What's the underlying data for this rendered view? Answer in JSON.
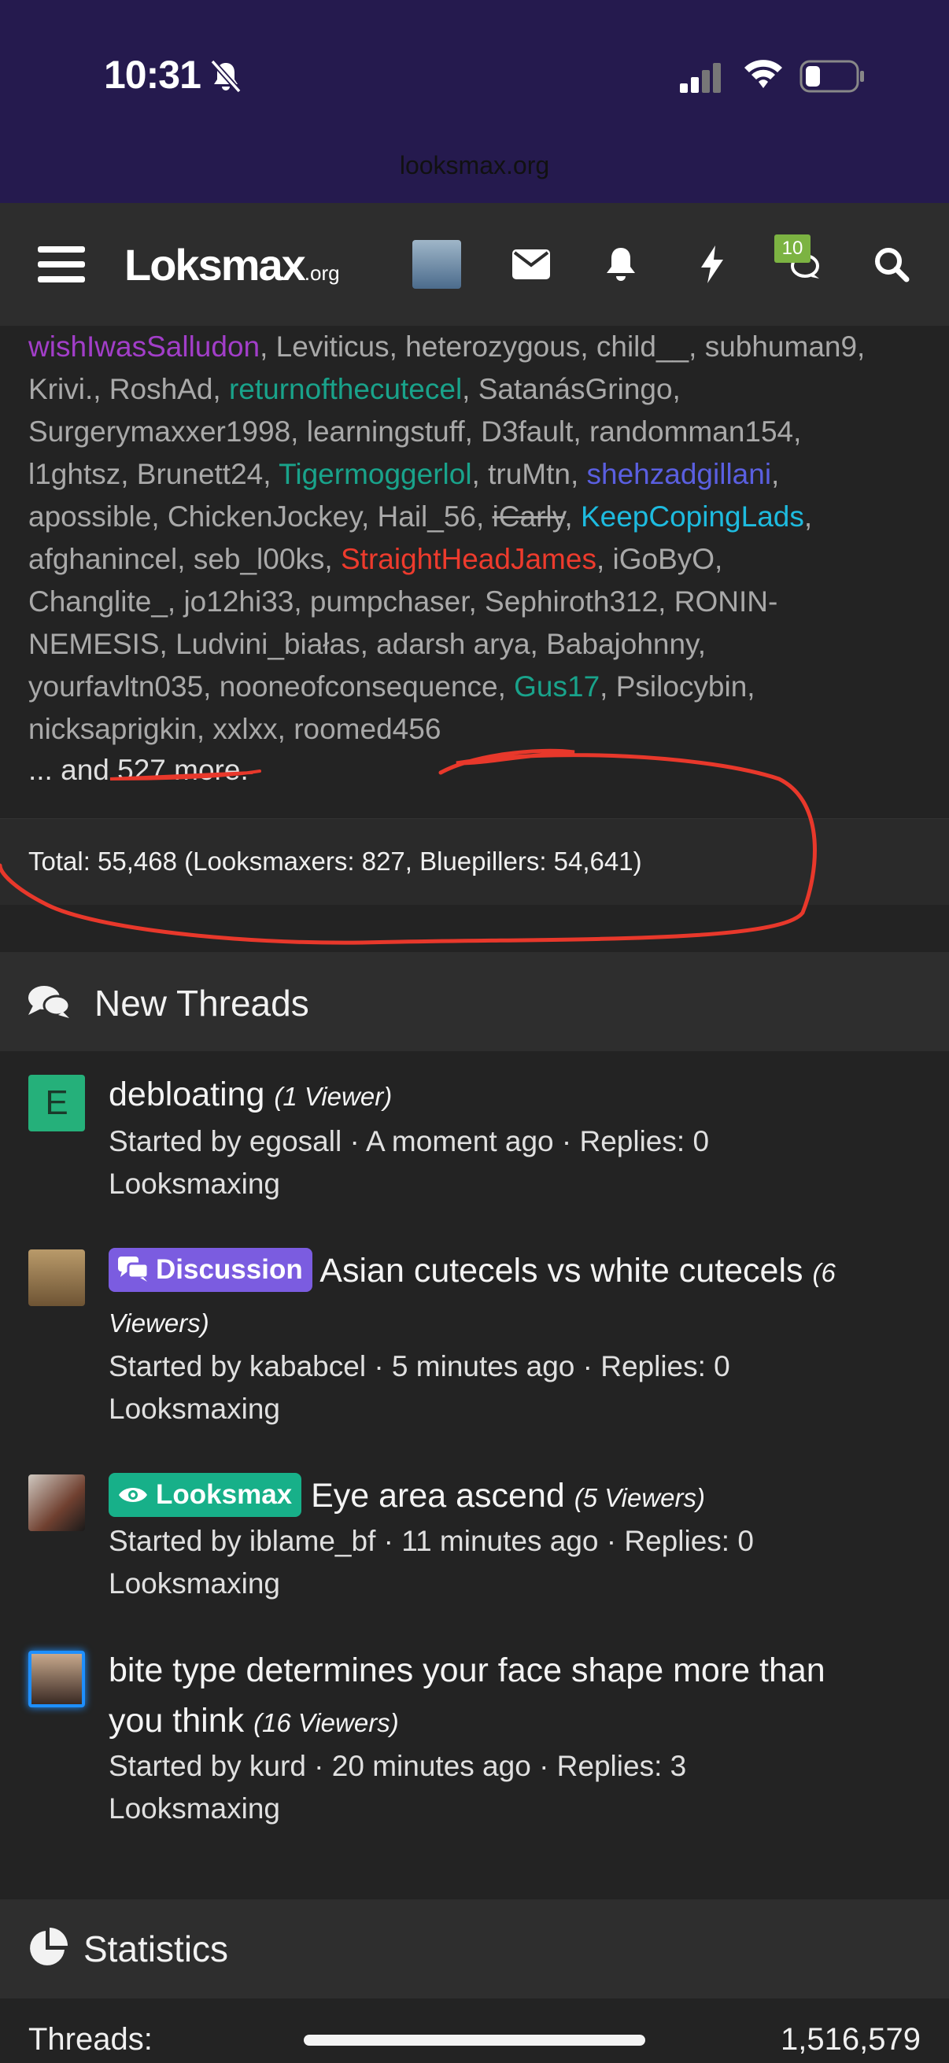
{
  "status": {
    "time": "10:31",
    "url": "looksmax.org"
  },
  "nav": {
    "logo_main": "Lo",
    "logo_rest": "ksmax",
    "logo_suffix": ".org",
    "notification_count": "10",
    "icons": [
      "menu-icon",
      "avatar",
      "mail-icon",
      "bell-icon",
      "lightning-icon",
      "chat-icon",
      "search-icon"
    ]
  },
  "members": {
    "lines": [
      [
        {
          "t": "wishIwasSalludon",
          "c": "purple"
        },
        {
          "t": ", Leviticus, heterozygous, child__, subhuman9,"
        }
      ],
      [
        {
          "t": "Krivi., RoshAd, "
        },
        {
          "t": "returnofthecutecel",
          "c": "teal"
        },
        {
          "t": ", SatanásGringo,"
        }
      ],
      [
        {
          "t": "Surgerymaxxer1998, learningstuff, D3fault, randomman154,"
        }
      ],
      [
        {
          "t": "l1ghtsz, Brunett24, "
        },
        {
          "t": "Tigermoggerlol",
          "c": "teal"
        },
        {
          "t": ", truMtn, "
        },
        {
          "t": "shehzadgillani",
          "c": "blue"
        },
        {
          "t": ","
        }
      ],
      [
        {
          "t": "apossible, ChickenJockey, Hail_56, "
        },
        {
          "t": "iCarly",
          "c": "strike"
        },
        {
          "t": ", "
        },
        {
          "t": "KeepCopingLads",
          "c": "cyan"
        },
        {
          "t": ","
        }
      ],
      [
        {
          "t": "afghanincel, seb_l00ks, "
        },
        {
          "t": "StraightHeadJames",
          "c": "red"
        },
        {
          "t": ", iGoByO,"
        }
      ],
      [
        {
          "t": "Changlite_, jo12hi33, pumpchaser, Sephiroth312, RONIN-"
        }
      ],
      [
        {
          "t": "NEMESIS, Ludvini_białas, adarsh arya, Babajohnny,"
        }
      ],
      [
        {
          "t": "yourfavltn035, nooneofconsequence, "
        },
        {
          "t": "Gus17",
          "c": "teal"
        },
        {
          "t": ", Psilocybin,"
        }
      ],
      [
        {
          "t": "nicksaprigkin, xxlxx, roomed456"
        }
      ]
    ],
    "more": "... and 527 more.",
    "total": "Total: 55,468 (Looksmaxers: 827, Bluepillers: 54,641)"
  },
  "new_threads": {
    "title": "New Threads",
    "threads": [
      {
        "avatar_letter": "E",
        "prefix": "",
        "title_line1": "debloating ",
        "title_line2": "",
        "viewers": "(1 Viewer)",
        "meta": "Started by egosall · A moment ago · Replies: 0",
        "forum": "Looksmaxing"
      },
      {
        "prefix": "Discussion",
        "title_line1": " Asian cutecels vs white cutecels ",
        "viewers_a": "(6",
        "viewers_b": "Viewers)",
        "meta": "Started by kababcel · 5 minutes ago · Replies: 0",
        "forum": "Looksmaxing"
      },
      {
        "prefix": "Looksmax",
        "title_line1": " Eye area ascend ",
        "viewers": "(5 Viewers)",
        "meta": "Started by iblame_bf · 11 minutes ago · Replies: 0",
        "forum": "Looksmaxing"
      },
      {
        "prefix": "",
        "title_line1": "bite type determines your face shape more than",
        "title_line2": "you think ",
        "viewers": "(16 Viewers)",
        "meta": "Started by kurd · 20 minutes ago · Replies: 3",
        "forum": "Looksmaxing"
      }
    ]
  },
  "statistics": {
    "title": "Statistics",
    "threads_label": "Threads:",
    "threads_value": "1,516,579"
  },
  "colors": {
    "statusbar": "#251a4e",
    "annotation": "#e8382b"
  }
}
